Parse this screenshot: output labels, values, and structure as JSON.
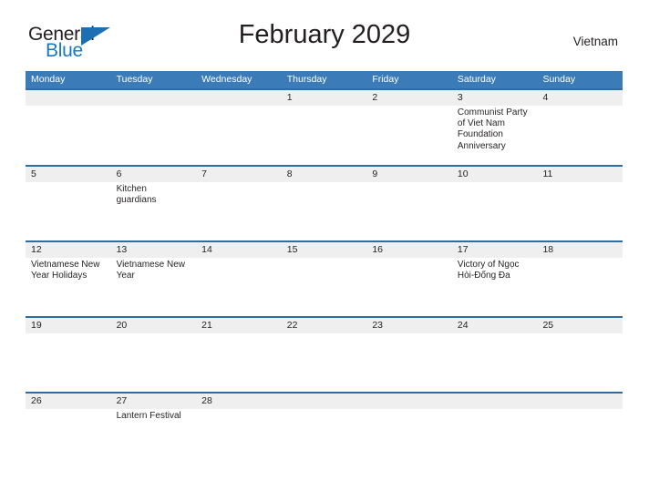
{
  "brand": {
    "name_part1": "General",
    "name_part2": "Blue",
    "flag_icon": "triangle-flag-icon",
    "accent_color": "#1878be"
  },
  "header": {
    "title": "February 2029",
    "country": "Vietnam"
  },
  "colors": {
    "weekday_header_bg": "#3b7cb8",
    "row_divider": "#2e6da4",
    "daynum_band_bg": "#efefef",
    "text": "#231f20"
  },
  "calendar": {
    "month": "February",
    "year": "2029",
    "weekday_headers": [
      "Monday",
      "Tuesday",
      "Wednesday",
      "Thursday",
      "Friday",
      "Saturday",
      "Sunday"
    ],
    "weeks": [
      {
        "days": [
          {
            "num": "",
            "events": []
          },
          {
            "num": "",
            "events": []
          },
          {
            "num": "",
            "events": []
          },
          {
            "num": "1",
            "events": []
          },
          {
            "num": "2",
            "events": []
          },
          {
            "num": "3",
            "events": [
              "Communist Party of Viet Nam Foundation Anniversary"
            ]
          },
          {
            "num": "4",
            "events": []
          }
        ]
      },
      {
        "days": [
          {
            "num": "5",
            "events": []
          },
          {
            "num": "6",
            "events": [
              "Kitchen guardians"
            ]
          },
          {
            "num": "7",
            "events": []
          },
          {
            "num": "8",
            "events": []
          },
          {
            "num": "9",
            "events": []
          },
          {
            "num": "10",
            "events": []
          },
          {
            "num": "11",
            "events": []
          }
        ]
      },
      {
        "days": [
          {
            "num": "12",
            "events": [
              "Vietnamese New Year Holidays"
            ]
          },
          {
            "num": "13",
            "events": [
              "Vietnamese New Year"
            ]
          },
          {
            "num": "14",
            "events": []
          },
          {
            "num": "15",
            "events": []
          },
          {
            "num": "16",
            "events": []
          },
          {
            "num": "17",
            "events": [
              "Victory of Ngọc Hòi-Đống Đa"
            ]
          },
          {
            "num": "18",
            "events": []
          }
        ]
      },
      {
        "days": [
          {
            "num": "19",
            "events": []
          },
          {
            "num": "20",
            "events": []
          },
          {
            "num": "21",
            "events": []
          },
          {
            "num": "22",
            "events": []
          },
          {
            "num": "23",
            "events": []
          },
          {
            "num": "24",
            "events": []
          },
          {
            "num": "25",
            "events": []
          }
        ]
      },
      {
        "days": [
          {
            "num": "26",
            "events": []
          },
          {
            "num": "27",
            "events": [
              "Lantern Festival"
            ]
          },
          {
            "num": "28",
            "events": []
          },
          {
            "num": "",
            "events": []
          },
          {
            "num": "",
            "events": []
          },
          {
            "num": "",
            "events": []
          },
          {
            "num": "",
            "events": []
          }
        ]
      }
    ]
  }
}
